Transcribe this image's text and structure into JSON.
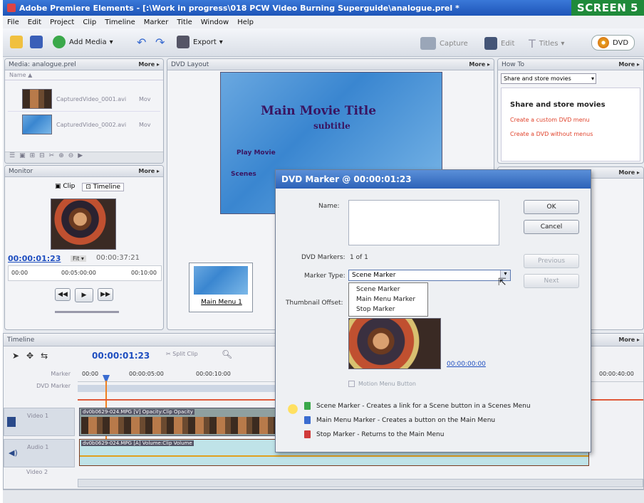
{
  "window": {
    "title": "Adobe Premiere Elements - [:\\Work in progress\\018 PCW Video Burning Superguide\\analogue.prel *"
  },
  "badge": "SCREEN 5",
  "menus": [
    "File",
    "Edit",
    "Project",
    "Clip",
    "Timeline",
    "Marker",
    "Title",
    "Window",
    "Help"
  ],
  "toolbar": {
    "add_media": "Add Media",
    "export": "Export",
    "capture": "Capture",
    "edit": "Edit",
    "titles": "Titles",
    "dvd": "DVD"
  },
  "media_panel": {
    "title": "Media: analogue.prel",
    "more": "More ▸",
    "items": [
      {
        "name": "CapturedVideo_0001.avi",
        "type": "Mov"
      },
      {
        "name": "CapturedVideo_0002.avi",
        "type": "Mov"
      }
    ]
  },
  "monitor": {
    "title": "Monitor",
    "more": "More ▸",
    "clip_tab": "Clip",
    "timeline_tab": "Timeline",
    "current_time": "00:00:01:23",
    "duration": "00:00:37:21",
    "ruler": [
      "00:00",
      "00:05:00:00",
      "00:10:00"
    ]
  },
  "dvd_layout": {
    "title": "DVD Layout",
    "more": "More ▸",
    "main_title": "Main Movie Title",
    "subtitle": "subtitle",
    "play": "Play Movie",
    "scenes": "Scenes",
    "menu_label": "Main Menu 1"
  },
  "howto": {
    "title": "How To",
    "more": "More ▸",
    "select": "Share and store movies",
    "heading": "Share and store movies",
    "links": [
      "Create a custom DVD menu",
      "Create a DVD without menus"
    ]
  },
  "timeline": {
    "title": "Timeline",
    "more": "More ▸",
    "time": "00:00:01:23",
    "split": "Split Clip",
    "ruler": [
      "00:00",
      "00:00:05:00",
      "00:00:10:00",
      "00:00:40:00"
    ],
    "rows": [
      "Marker",
      "DVD Marker",
      "Video 1",
      "Audio 1",
      "Video 2"
    ],
    "clip_video": "dv0b0629-024.MPG [V] Opacity:Clip Opacity",
    "clip_audio": "dv0b0629-024.MPG [A] Volume:Clip Volume"
  },
  "dialog": {
    "title": "DVD Marker @ 00:00:01:23",
    "name_label": "Name:",
    "name_value": "",
    "markers_label": "DVD Markers:",
    "markers_value": "1 of 1",
    "type_label": "Marker Type:",
    "type_value": "Scene Marker",
    "type_options": [
      "Scene Marker",
      "Main Menu Marker",
      "Stop Marker"
    ],
    "thumb_label": "Thumbnail Offset:",
    "thumb_time": "00:00:00:00",
    "motion_label": "Motion Menu Button",
    "ok": "OK",
    "cancel": "Cancel",
    "previous": "Previous",
    "next": "Next",
    "legend": [
      "Scene Marker - Creates a link for a Scene button in a Scenes Menu",
      "Main Menu Marker - Creates a button on the Main Menu",
      "Stop Marker - Returns to the Main Menu"
    ]
  },
  "colors": {
    "accent": "#2d62b8",
    "badge": "#1f8a3a",
    "scene_marker": "#3aa84a",
    "menu_marker": "#3a6cd0",
    "stop_marker": "#d03a3a",
    "link": "#e0432c"
  }
}
